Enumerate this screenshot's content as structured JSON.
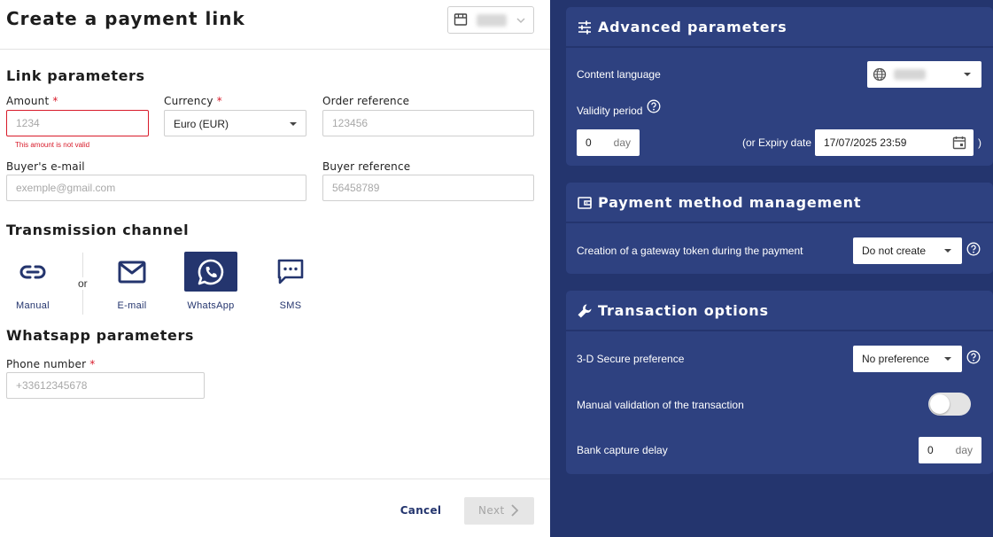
{
  "page": {
    "title": "Create a payment link",
    "shop_selector": {
      "icon": "store-icon"
    }
  },
  "link_parameters": {
    "heading": "Link parameters",
    "amount": {
      "label": "Amount",
      "required_mark": "*",
      "placeholder": "1234",
      "value": "",
      "error": "This amount is not valid"
    },
    "currency": {
      "label": "Currency",
      "required_mark": "*",
      "value": "Euro (EUR)"
    },
    "order_reference": {
      "label": "Order reference",
      "placeholder": "123456",
      "value": ""
    },
    "buyer_email": {
      "label": "Buyer's e-mail",
      "placeholder": "exemple@gmail.com",
      "value": ""
    },
    "buyer_reference": {
      "label": "Buyer reference",
      "placeholder": "56458789",
      "value": ""
    }
  },
  "transmission": {
    "heading": "Transmission channel",
    "or_label": "or",
    "channels": [
      {
        "label": "Manual",
        "icon": "link-icon",
        "active": false
      },
      {
        "label": "E-mail",
        "icon": "mail-icon",
        "active": false
      },
      {
        "label": "WhatsApp",
        "icon": "whatsapp-icon",
        "active": true
      },
      {
        "label": "SMS",
        "icon": "sms-icon",
        "active": false
      }
    ]
  },
  "whatsapp": {
    "heading": "Whatsapp parameters",
    "phone": {
      "label": "Phone number",
      "required_mark": "*",
      "placeholder": "+33612345678",
      "value": ""
    }
  },
  "footer": {
    "cancel_label": "Cancel",
    "next_label": "Next"
  },
  "advanced": {
    "title": "Advanced parameters",
    "icon": "sliders-icon",
    "content_language": {
      "label": "Content language",
      "icon": "globe-icon"
    },
    "validity": {
      "label": "Validity period",
      "days_value": "0",
      "days_unit": "day",
      "expiry_prefix": "(or Expiry date",
      "expiry_value": "17/07/2025 23:59",
      "expiry_suffix": ")"
    }
  },
  "payment_method": {
    "title": "Payment method management",
    "icon": "wallet-icon",
    "token": {
      "label": "Creation of a gateway token during the payment",
      "value": "Do not create"
    }
  },
  "transaction": {
    "title": "Transaction options",
    "icon": "wrench-icon",
    "secure3d": {
      "label": "3-D Secure preference",
      "value": "No preference"
    },
    "manual_validation": {
      "label": "Manual validation of the transaction",
      "enabled": false
    },
    "capture_delay": {
      "label": "Bank capture delay",
      "value": "0",
      "unit": "day"
    }
  },
  "colors": {
    "navy": "#24356e",
    "card": "#2e4180",
    "error": "#d81b2a"
  }
}
